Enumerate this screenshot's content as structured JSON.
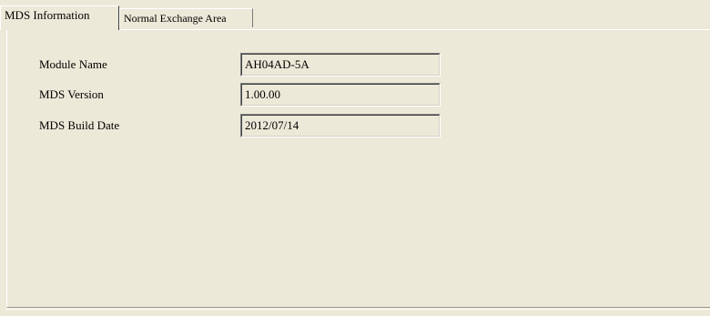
{
  "tabs": [
    {
      "label": "MDS Information",
      "active": true
    },
    {
      "label": "Normal Exchange Area",
      "active": false
    }
  ],
  "fields": [
    {
      "label": "Module Name",
      "value": "AH04AD-5A"
    },
    {
      "label": "MDS Version",
      "value": "1.00.00"
    },
    {
      "label": "MDS Build Date",
      "value": "2012/07/14"
    }
  ]
}
